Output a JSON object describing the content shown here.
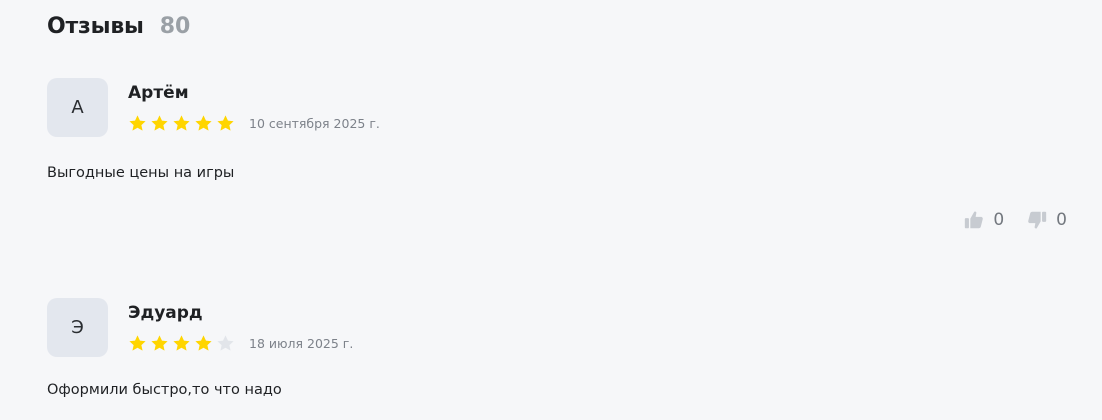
{
  "reviews_section": {
    "title": "Отзывы",
    "count": "80"
  },
  "colors": {
    "star_filled": "#ffd500",
    "star_empty": "#e2e5ea",
    "avatar_bg": "#e3e7ee",
    "vote_icon": "#c7cbd1"
  },
  "reviews": [
    {
      "initial": "А",
      "author": "Артём",
      "rating": 5,
      "max_rating": 5,
      "date": "10 сентября 2025 г.",
      "text": "Выгодные цены на игры",
      "likes": "0",
      "dislikes": "0"
    },
    {
      "initial": "Э",
      "author": "Эдуард",
      "rating": 4,
      "max_rating": 5,
      "date": "18 июля 2025 г.",
      "text": "Оформили быстро,то что надо"
    }
  ],
  "icons": {
    "star": "star-icon",
    "like": "thumbs-up-icon",
    "dislike": "thumbs-down-icon"
  }
}
